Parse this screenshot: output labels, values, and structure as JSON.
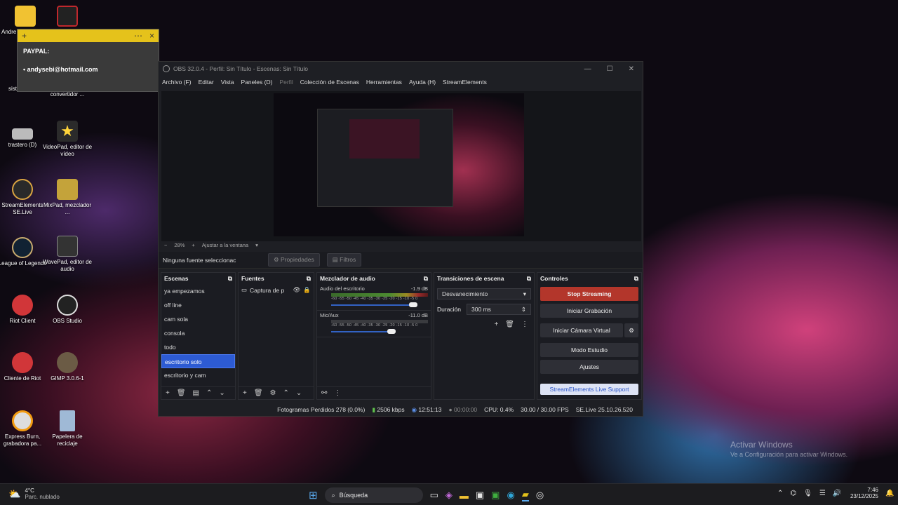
{
  "desktop": {
    "icons": [
      {
        "label": "Andre\nAcce",
        "icon": "folder-icon"
      },
      {
        "label": "",
        "icon": "red-app-icon"
      },
      {
        "label": "sist",
        "icon": "shortcut-icon"
      },
      {
        "label": "convertidor ...",
        "icon": "app-icon"
      },
      {
        "label": "trastero (D)",
        "icon": "drive-icon"
      },
      {
        "label": "VideoPad, editor de vídeo",
        "icon": "videopad-icon"
      },
      {
        "label": "StreamElements SE.Live",
        "icon": "streamelements-icon"
      },
      {
        "label": "MixPad, mezclador ...",
        "icon": "mixpad-icon"
      },
      {
        "label": "League of Legends",
        "icon": "league-icon"
      },
      {
        "label": "WavePad, editor de audio",
        "icon": "wavepad-icon"
      },
      {
        "label": "Riot Client",
        "icon": "riot-icon"
      },
      {
        "label": "OBS Studio",
        "icon": "obs-icon"
      },
      {
        "label": "Cliente de Riot",
        "icon": "riot-icon"
      },
      {
        "label": "GIMP 3.0.6-1",
        "icon": "gimp-icon"
      },
      {
        "label": "Express Burn, grabadora pa...",
        "icon": "expressburn-icon"
      },
      {
        "label": "Papelera de reciclaje",
        "icon": "recycle-bin-icon"
      }
    ]
  },
  "sticky": {
    "line1": "PAYPAL:",
    "line2": "• andysebi@hotmail.com"
  },
  "obs": {
    "title": "OBS 32.0.4 - Perfil: Sin Título - Escenas: Sin Título",
    "menu": [
      "Archivo (F)",
      "Editar",
      "Vista",
      "Paneles (D)",
      "Perfil",
      "Colección de Escenas",
      "Herramientas",
      "Ayuda (H)",
      "StreamElements"
    ],
    "zoom": {
      "minus": "−",
      "value": "28%",
      "plus": "+",
      "fit": "Ajustar a la ventana"
    },
    "source_bar": {
      "none": "Ninguna fuente seleccionac",
      "props": "Propiedades",
      "filters": "Filtros"
    },
    "docks": {
      "scenes": {
        "title": "Escenas",
        "items": [
          "ya empezamos",
          "off line",
          "cam sola",
          "consola",
          "todo",
          "escritorio solo",
          "escritorio y cam"
        ],
        "selected": 5
      },
      "sources": {
        "title": "Fuentes",
        "items": [
          "Captura de p"
        ]
      },
      "mixer": {
        "title": "Mezclador de audio",
        "tracks": [
          {
            "name": "Audio del escritorio",
            "db": "-1.9 dB",
            "volume": 0.85
          },
          {
            "name": "Mic/Aux",
            "db": "-11.0 dB",
            "volume": 0.62
          }
        ],
        "scale": "-60 -55 -50 -45 -40 -35 -30 -25 -20 -15 -10 -5 0"
      },
      "transitions": {
        "title": "Transiciones de escena",
        "type": "Desvanecimiento",
        "duration_label": "Duración",
        "duration": "300 ms"
      },
      "controls": {
        "title": "Controles",
        "buttons": [
          "Stop Streaming",
          "Iniciar Grabación",
          "Iniciar Cámara Virtual",
          "Modo Estudio",
          "Ajustes"
        ],
        "support": "StreamElements Live Support"
      }
    },
    "status": {
      "dropped": "Fotogramas Perdidos 278 (0.0%)",
      "bitrate": "2506 kbps",
      "stream_time": "12:51:13",
      "rec_time": "00:00:00",
      "cpu": "CPU: 0.4%",
      "fps": "30.00 / 30.00 FPS",
      "version": "SE.Live 25.10.26.520"
    }
  },
  "watermark": {
    "line1": "Activar Windows",
    "line2": "Ve a Configuración para activar Windows."
  },
  "taskbar": {
    "weather_temp": "4°C",
    "weather_desc": "Parc. nublado",
    "search": "Búsqueda",
    "time": "7:46",
    "date": "23/12/2025"
  },
  "colors": {
    "accent": "#2d5bd3",
    "stop": "#b3362b",
    "sticky": "#e5c21b"
  }
}
